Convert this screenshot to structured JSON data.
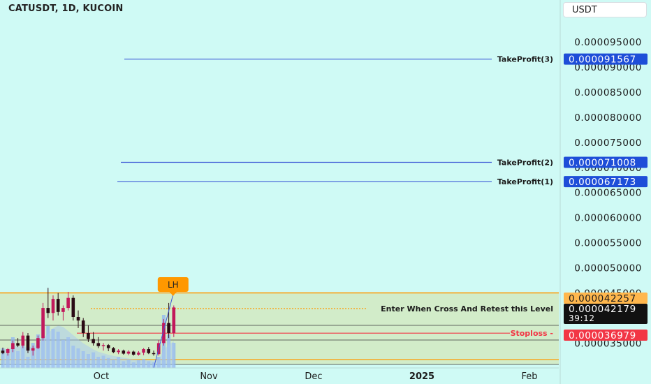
{
  "header": {
    "symbol_title": "CATUSDT, 1D, KUCOIN",
    "currency": "USDT"
  },
  "colors": {
    "background": "#cffaf5",
    "candle_up": "#c2185b",
    "candle_down": "#2a0a14",
    "range_band": "#d2ecc9",
    "range_border": "#ff9800",
    "target_line": "#3f5bd6",
    "target_badge": "#1e4ed8",
    "entry_line": "#ff9800",
    "stop_line": "#f23645",
    "volume": "#8fb6f0"
  },
  "chart_data": {
    "type": "candlestick",
    "title": "CATUSDT, 1D, KUCOIN",
    "y_axis_ticks": [
      "0.000095000",
      "0.000090000",
      "0.000085000",
      "0.000080000",
      "0.000075000",
      "0.000070000",
      "0.000065000",
      "0.000060000",
      "0.000055000",
      "0.000050000",
      "0.000045000",
      "0.000035000"
    ],
    "ylim": [
      3.25e-05,
      0.000101
    ],
    "x_axis_labels": [
      "Oct",
      "Nov",
      "Dec",
      "2025",
      "Feb"
    ],
    "levels": [
      {
        "label": "TakeProfit(3)",
        "price": 9.1567e-05,
        "price_label": "0.000091567"
      },
      {
        "label": "TakeProfit(2)",
        "price": 7.1008e-05,
        "price_label": "0.000071008"
      },
      {
        "label": "TakeProfit(1)",
        "price": 6.7173e-05,
        "price_label": "0.000067173"
      },
      {
        "label": "Enter When Cross And Retest this Level",
        "price": 4.2257e-05,
        "price_label": "0.000042257"
      },
      {
        "label": "Stoploss",
        "price": 3.6979e-05,
        "price_label": "0.000036979"
      }
    ],
    "last_price": {
      "price": 4.2179e-05,
      "label": "0.000042179",
      "countdown": "39:12"
    },
    "annotation": {
      "text": "LH"
    },
    "candles": [
      {
        "o": 3.35e-05,
        "h": 3.41e-05,
        "l": 3.28e-05,
        "c": 3.3e-05
      },
      {
        "o": 3.3e-05,
        "h": 3.4e-05,
        "l": 3.25e-05,
        "c": 3.38e-05
      },
      {
        "o": 3.38e-05,
        "h": 3.55e-05,
        "l": 3.32e-05,
        "c": 3.5e-05
      },
      {
        "o": 3.5e-05,
        "h": 3.6e-05,
        "l": 3.42e-05,
        "c": 3.45e-05
      },
      {
        "o": 3.45e-05,
        "h": 3.72e-05,
        "l": 3.4e-05,
        "c": 3.65e-05
      },
      {
        "o": 3.65e-05,
        "h": 3.7e-05,
        "l": 3.3e-05,
        "c": 3.35e-05
      },
      {
        "o": 3.35e-05,
        "h": 3.45e-05,
        "l": 3.25e-05,
        "c": 3.4e-05
      },
      {
        "o": 3.4e-05,
        "h": 3.65e-05,
        "l": 3.38e-05,
        "c": 3.6e-05
      },
      {
        "o": 3.6e-05,
        "h": 4.3e-05,
        "l": 3.55e-05,
        "c": 4.2e-05
      },
      {
        "o": 4.2e-05,
        "h": 4.6e-05,
        "l": 4e-05,
        "c": 4.1e-05
      },
      {
        "o": 4.1e-05,
        "h": 4.45e-05,
        "l": 3.95e-05,
        "c": 4.38e-05
      },
      {
        "o": 4.38e-05,
        "h": 4.5e-05,
        "l": 4.05e-05,
        "c": 4.12e-05
      },
      {
        "o": 4.12e-05,
        "h": 4.25e-05,
        "l": 3.95e-05,
        "c": 4.2e-05
      },
      {
        "o": 4.2e-05,
        "h": 4.52e-05,
        "l": 4.15e-05,
        "c": 4.4e-05
      },
      {
        "o": 4.4e-05,
        "h": 4.45e-05,
        "l": 3.95e-05,
        "c": 4.02e-05
      },
      {
        "o": 4.02e-05,
        "h": 4.15e-05,
        "l": 3.8e-05,
        "c": 3.95e-05
      },
      {
        "o": 3.95e-05,
        "h": 4e-05,
        "l": 3.62e-05,
        "c": 3.7e-05
      },
      {
        "o": 3.7e-05,
        "h": 3.85e-05,
        "l": 3.52e-05,
        "c": 3.58e-05
      },
      {
        "o": 3.58e-05,
        "h": 3.72e-05,
        "l": 3.45e-05,
        "c": 3.5e-05
      },
      {
        "o": 3.5e-05,
        "h": 3.62e-05,
        "l": 3.4e-05,
        "c": 3.44e-05
      },
      {
        "o": 3.44e-05,
        "h": 3.5e-05,
        "l": 3.35e-05,
        "c": 3.46e-05
      },
      {
        "o": 3.46e-05,
        "h": 3.48e-05,
        "l": 3.34e-05,
        "c": 3.4e-05
      },
      {
        "o": 3.4e-05,
        "h": 3.42e-05,
        "l": 3.3e-05,
        "c": 3.32e-05
      },
      {
        "o": 3.32e-05,
        "h": 3.38e-05,
        "l": 3.28e-05,
        "c": 3.35e-05
      },
      {
        "o": 3.35e-05,
        "h": 3.37e-05,
        "l": 3.27e-05,
        "c": 3.29e-05
      },
      {
        "o": 3.29e-05,
        "h": 3.36e-05,
        "l": 3.26e-05,
        "c": 3.33e-05
      },
      {
        "o": 3.33e-05,
        "h": 3.35e-05,
        "l": 3.25e-05,
        "c": 3.27e-05
      },
      {
        "o": 3.27e-05,
        "h": 3.34e-05,
        "l": 3.25e-05,
        "c": 3.31e-05
      },
      {
        "o": 3.31e-05,
        "h": 3.4e-05,
        "l": 3.26e-05,
        "c": 3.38e-05
      },
      {
        "o": 3.38e-05,
        "h": 3.42e-05,
        "l": 3.28e-05,
        "c": 3.3e-05
      },
      {
        "o": 3.3e-05,
        "h": 3.35e-05,
        "l": 3.25e-05,
        "c": 3.28e-05
      },
      {
        "o": 3.28e-05,
        "h": 3.56e-05,
        "l": 3.25e-05,
        "c": 3.5e-05
      },
      {
        "o": 3.5e-05,
        "h": 3.98e-05,
        "l": 3.45e-05,
        "c": 3.9e-05
      },
      {
        "o": 3.9e-05,
        "h": 4.3e-05,
        "l": 3.6e-05,
        "c": 3.7e-05
      },
      {
        "o": 3.7e-05,
        "h": 4.25e-05,
        "l": 3.62e-05,
        "c": 4.21e-05
      }
    ],
    "volumes": [
      0.35,
      0.25,
      0.55,
      0.3,
      0.4,
      0.2,
      0.45,
      0.6,
      0.9,
      0.75,
      0.7,
      0.65,
      0.5,
      0.55,
      0.4,
      0.35,
      0.3,
      0.25,
      0.28,
      0.2,
      0.22,
      0.18,
      0.15,
      0.2,
      0.12,
      0.15,
      0.1,
      0.14,
      0.16,
      0.12,
      0.1,
      0.2,
      0.95,
      0.6,
      0.45
    ]
  }
}
